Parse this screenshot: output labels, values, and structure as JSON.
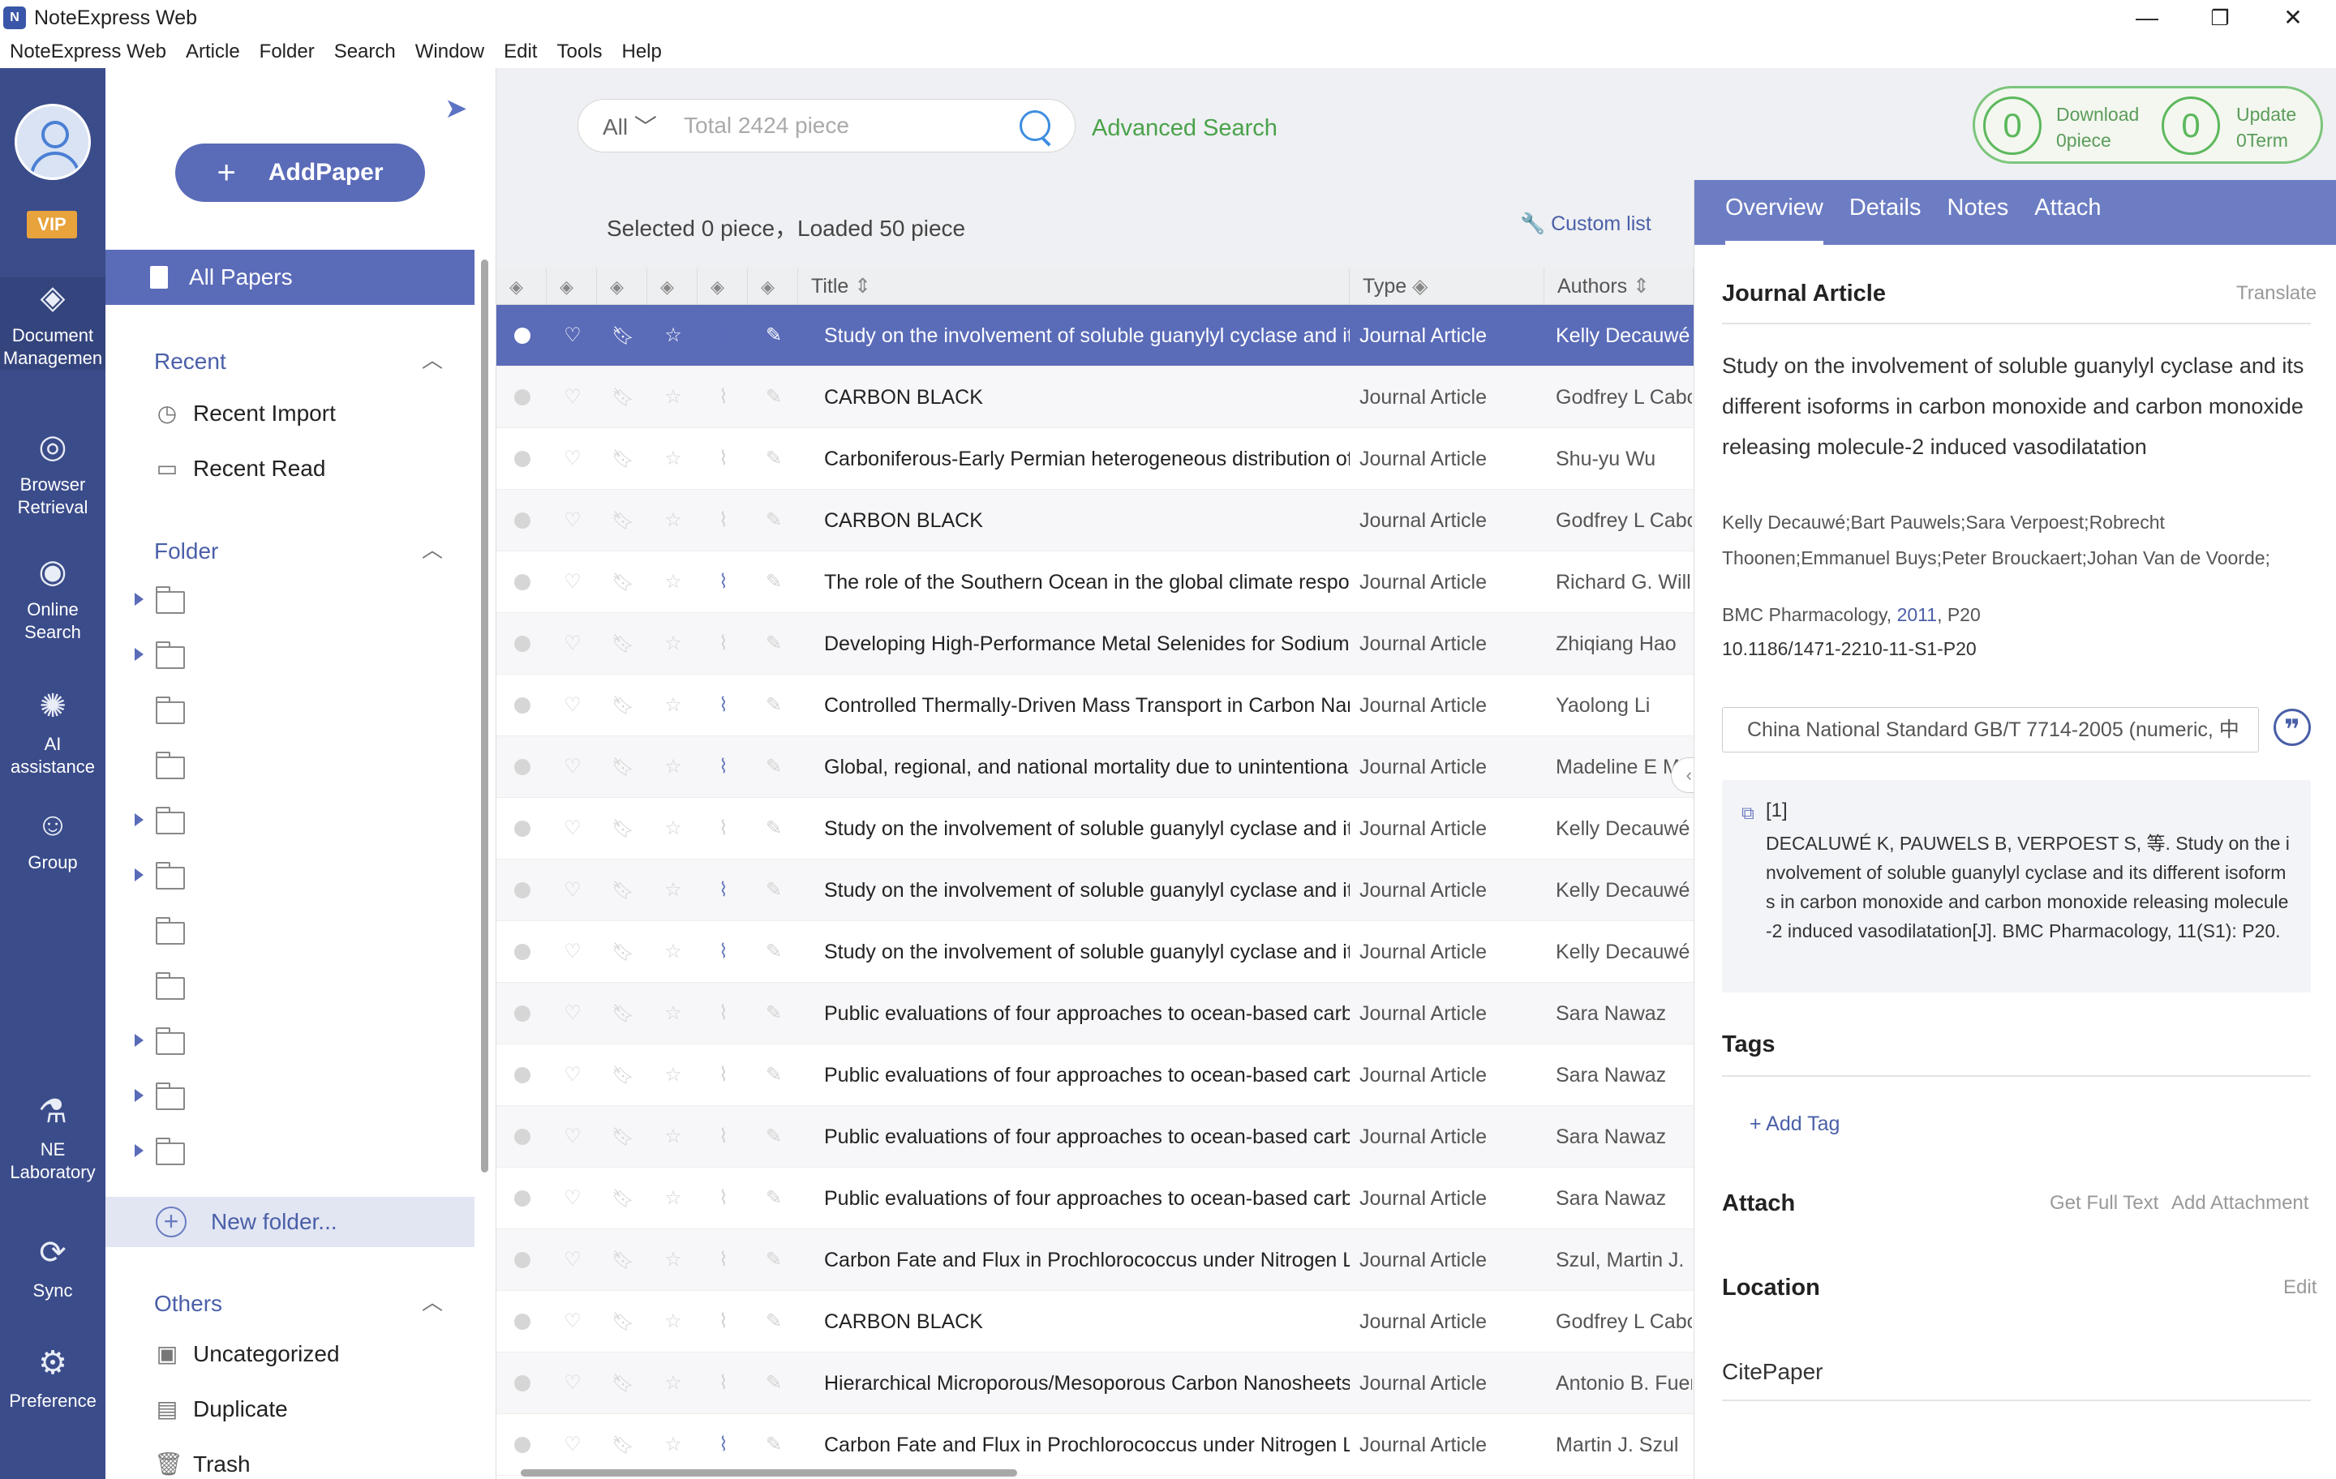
{
  "window": {
    "title": "NoteExpress Web",
    "logo_letter": "N",
    "controls": {
      "minimize": "—",
      "restore": "❐",
      "close": "✕"
    }
  },
  "menu": [
    "NoteExpress Web",
    "Article",
    "Folder",
    "Search",
    "Window",
    "Edit",
    "Tools",
    "Help"
  ],
  "leftnav": {
    "vip": "VIP",
    "items": [
      {
        "label": "Document Managemen",
        "icon": "layers-icon"
      },
      {
        "label": "Browser Retrieval",
        "icon": "globe-icon"
      },
      {
        "label": "Online Search",
        "icon": "eye-icon"
      },
      {
        "label": "AI assistance",
        "icon": "bulb-icon"
      },
      {
        "label": "Group",
        "icon": "people-icon"
      },
      {
        "label": "NE Laboratory",
        "icon": "microscope-icon"
      },
      {
        "label": "Sync",
        "icon": "sync-icon"
      },
      {
        "label": "Preference",
        "icon": "gear-icon"
      }
    ]
  },
  "folders": {
    "add_paper": "AddPaper",
    "all_papers": "All Papers",
    "recent": {
      "title": "Recent",
      "items": [
        "Recent Import",
        "Recent Read"
      ]
    },
    "folder_title": "Folder",
    "new_folder": "New folder...",
    "others": {
      "title": "Others",
      "items": [
        "Uncategorized",
        "Duplicate",
        "Trash"
      ]
    }
  },
  "search": {
    "scope": "All",
    "placeholder": "Total 2424 piece",
    "advanced": "Advanced Search"
  },
  "sync_status": {
    "download_count": "0",
    "download_label": "Download",
    "download_sub": "0piece",
    "update_count": "0",
    "update_label": "Update",
    "update_sub": "0Term"
  },
  "list": {
    "selection_info": "Selected 0 piece，Loaded 50 piece",
    "custom_list": "Custom list",
    "columns": {
      "title": "Title",
      "type": "Type",
      "authors": "Authors"
    },
    "rows": [
      {
        "title": "Study on the involvement of soluble guanylyl cyclase and its different isoforms",
        "type": "Journal Article",
        "authors": "Kelly Decauwé",
        "attach": false,
        "selected": true
      },
      {
        "title": "CARBON BLACK",
        "type": "Journal Article",
        "authors": "Godfrey L Cabc",
        "attach": false
      },
      {
        "title": "Carboniferous-Early Permian heterogeneous distribution of p",
        "type": "Journal Article",
        "authors": "Shu-yu Wu",
        "attach": false
      },
      {
        "title": "CARBON BLACK",
        "type": "Journal Article",
        "authors": "Godfrey L Cabc",
        "attach": false
      },
      {
        "title": "The role of the Southern Ocean in the global climate respons",
        "type": "Journal Article",
        "authors": "Richard G. Willi",
        "attach": true
      },
      {
        "title": "Developing High-Performance Metal Selenides for Sodium-Io",
        "type": "Journal Article",
        "authors": "Zhiqiang Hao",
        "attach": false
      },
      {
        "title": "Controlled Thermally-Driven Mass Transport in Carbon Nano",
        "type": "Journal Article",
        "authors": "Yaolong Li",
        "attach": true
      },
      {
        "title": "Global, regional, and national mortality due to unintentional",
        "type": "Journal Article",
        "authors": "Madeline E M",
        "attach": true
      },
      {
        "title": "Study on the involvement of soluble guanylyl cyclase and its",
        "type": "Journal Article",
        "authors": "Kelly Decauwé",
        "attach": false
      },
      {
        "title": "Study on the involvement of soluble guanylyl cyclase and its",
        "type": "Journal Article",
        "authors": "Kelly Decauwé",
        "attach": true
      },
      {
        "title": "Study on the involvement of soluble guanylyl cyclase and its",
        "type": "Journal Article",
        "authors": "Kelly Decauwé",
        "attach": true
      },
      {
        "title": "Public evaluations of four approaches to ocean-based carbon",
        "type": "Journal Article",
        "authors": "Sara Nawaz",
        "attach": false
      },
      {
        "title": "Public evaluations of four approaches to ocean-based carbon",
        "type": "Journal Article",
        "authors": "Sara Nawaz",
        "attach": false
      },
      {
        "title": "Public evaluations of four approaches to ocean-based carbon",
        "type": "Journal Article",
        "authors": "Sara Nawaz",
        "attach": false
      },
      {
        "title": "Public evaluations of four approaches to ocean-based carbon",
        "type": "Journal Article",
        "authors": "Sara Nawaz",
        "attach": false
      },
      {
        "title": "Carbon Fate and Flux in Prochlorococcus under Nitrogen Limi",
        "type": "Journal Article",
        "authors": "Szul, Martin J.",
        "attach": false
      },
      {
        "title": "CARBON BLACK",
        "type": "Journal Article",
        "authors": "Godfrey L Cabc",
        "attach": false
      },
      {
        "title": "Hierarchical Microporous/Mesoporous Carbon Nanosheets f",
        "type": "Journal Article",
        "authors": "Antonio B. Fuer",
        "attach": false
      },
      {
        "title": "Carbon Fate and Flux in Prochlorococcus under Nitrogen Limi",
        "type": "Journal Article",
        "authors": "Martin J. Szul",
        "attach": true
      }
    ]
  },
  "details": {
    "tabs": [
      "Overview",
      "Details",
      "Notes",
      "Attach"
    ],
    "type": "Journal Article",
    "translate": "Translate",
    "title": "Study on the involvement of soluble guanylyl cyclase and its different isoforms in carbon monoxide and carbon monoxide releasing molecule-2 induced vasodilatation",
    "authors": "Kelly Decauwé;Bart Pauwels;Sara Verpoest;Robrecht Thoonen;Emmanuel Buys;Peter Brouckaert;Johan Van de Voorde;",
    "journal_prefix": "BMC Pharmacology, ",
    "year": "2011",
    "page": ", P20",
    "doi": "10.1186/1471-2210-11-S1-P20",
    "cite_style": "China National Standard GB/T 7714-2005 (numeric, 中",
    "citation_num": "[1]",
    "citation_text": "DECALUWÉ K, PAUWELS B, VERPOEST S, 等. Study on the involvement of soluble guanylyl cyclase and its different isoforms in carbon monoxide and carbon monoxide releasing molecule-2 induced vasodilatation[J]. BMC Pharmacology, 11(S1): P20.",
    "tags_title": "Tags",
    "add_tag": "+ Add Tag",
    "attach_title": "Attach",
    "get_full_text": "Get Full Text",
    "add_attachment": "Add Attachment",
    "location_title": "Location",
    "edit": "Edit",
    "citepaper": "CitePaper"
  },
  "colors": {
    "nav_bg": "#3b4c8a",
    "accent": "#5a6bb8",
    "green": "#4aa24a"
  }
}
